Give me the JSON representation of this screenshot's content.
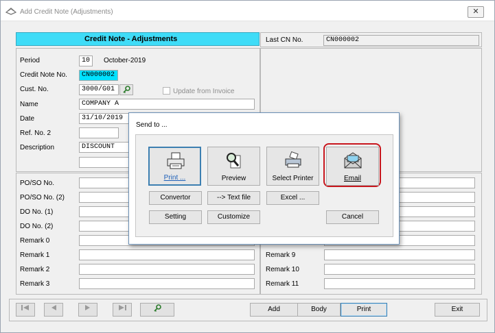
{
  "window": {
    "title": "Add Credit Note (Adjustments)",
    "close": "✕"
  },
  "header": {
    "title": "Credit Note - Adjustments",
    "last_cn_label": "Last CN No.",
    "last_cn_value": "CN000002"
  },
  "form": {
    "period_label": "Period",
    "period_value": "10",
    "period_text": "October-2019",
    "cn_label": "Credit Note No.",
    "cn_value": "CN000002",
    "cust_label": "Cust. No.",
    "cust_value": "3000/G01",
    "update_label": "Update from Invoice",
    "name_label": "Name",
    "name_value": "COMPANY A",
    "date_label": "Date",
    "date_value": "31/10/2019",
    "ref_label": "Ref. No. 2",
    "ref_value": "",
    "desc_label": "Description",
    "desc_value": "DISCOUNT",
    "desc_value2": ""
  },
  "left_fields": [
    {
      "label": "PO/SO No.",
      "value": ""
    },
    {
      "label": "PO/SO No. (2)",
      "value": ""
    },
    {
      "label": "DO No. (1)",
      "value": ""
    },
    {
      "label": "DO No. (2)",
      "value": ""
    },
    {
      "label": "Remark 0",
      "value": ""
    },
    {
      "label": "Remark 1",
      "value": ""
    },
    {
      "label": "Remark 2",
      "value": ""
    },
    {
      "label": "Remark 3",
      "value": ""
    }
  ],
  "right_fields": [
    {
      "label": "Remark 9",
      "value": ""
    },
    {
      "label": "Remark 10",
      "value": ""
    },
    {
      "label": "Remark 11",
      "value": ""
    }
  ],
  "footer": {
    "add": "Add",
    "body": "Body",
    "print": "Print",
    "exit": "Exit"
  },
  "dialog": {
    "title": "Send to ...",
    "print": "Print ...",
    "preview": "Preview",
    "select_printer": "Select Printer",
    "email": "Email",
    "convertor": "Convertor",
    "textfile": "--> Text file",
    "excel": "Excel ...",
    "setting": "Setting",
    "customize": "Customize",
    "cancel": "Cancel"
  },
  "colors": {
    "title_band": "#3fdcf7",
    "highlight": "#00e1ff",
    "email_ring": "#c8161d"
  }
}
